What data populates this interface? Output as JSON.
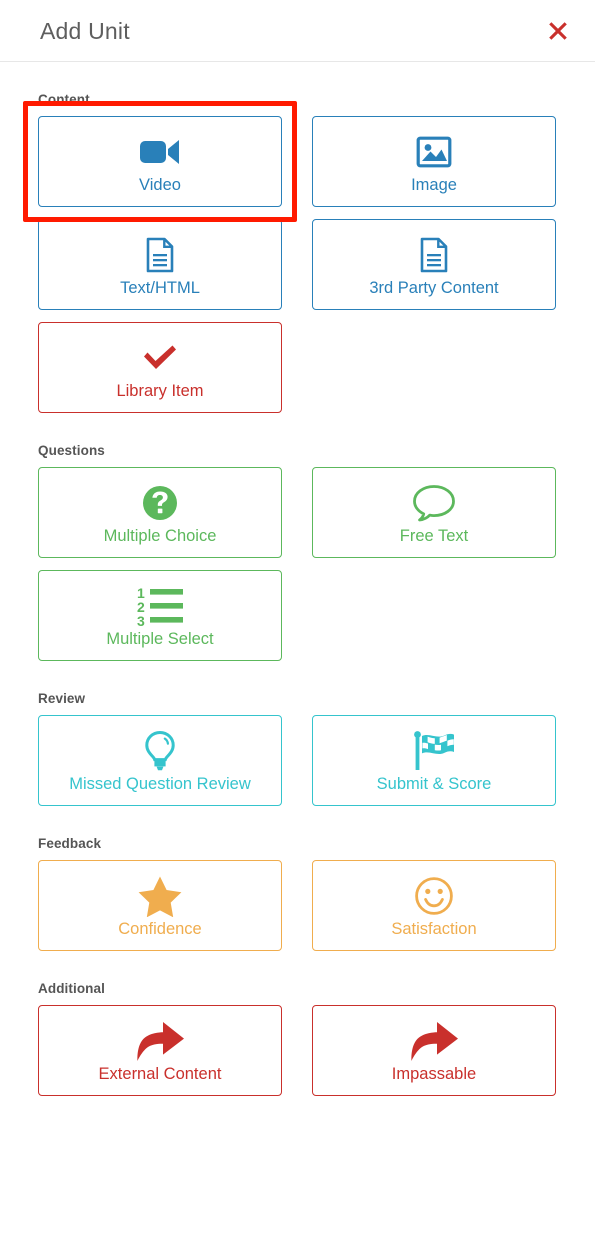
{
  "header": {
    "title": "Add Unit",
    "close_label": "Close",
    "close_icon": "close-x-icon",
    "close_color": "#c9302c"
  },
  "colors": {
    "content": "#2980b9",
    "library": "#c9302c",
    "questions": "#5cb85c",
    "review": "#35c4cd",
    "feedback": "#f0ad4e",
    "additional": "#c9302c",
    "selection_highlight": "#ff1a00",
    "section_label": "#555555",
    "title": "#5e5e5e"
  },
  "sections": [
    {
      "label": "Content",
      "items": [
        {
          "label": "Video",
          "icon": "video-camera-icon",
          "color": "blue",
          "selected": true
        },
        {
          "label": "Image",
          "icon": "image-picture-icon",
          "color": "blue",
          "selected": false
        },
        {
          "label": "Text/HTML",
          "icon": "document-icon",
          "color": "blue",
          "selected": false
        },
        {
          "label": "3rd Party Content",
          "icon": "document-icon",
          "color": "blue",
          "selected": false
        },
        {
          "label": "Library Item",
          "icon": "checkmark-icon",
          "color": "red",
          "selected": false
        }
      ]
    },
    {
      "label": "Questions",
      "items": [
        {
          "label": "Multiple Choice",
          "icon": "question-circle-icon",
          "color": "green",
          "selected": false
        },
        {
          "label": "Free Text",
          "icon": "speech-bubble-icon",
          "color": "green",
          "selected": false
        },
        {
          "label": "Multiple Select",
          "icon": "numbered-list-icon",
          "color": "green",
          "selected": false
        }
      ]
    },
    {
      "label": "Review",
      "items": [
        {
          "label": "Missed Question Review",
          "icon": "lightbulb-icon",
          "color": "teal",
          "selected": false
        },
        {
          "label": "Submit & Score",
          "icon": "checkered-flag-icon",
          "color": "teal",
          "selected": false
        }
      ]
    },
    {
      "label": "Feedback",
      "items": [
        {
          "label": "Confidence",
          "icon": "star-icon",
          "color": "orange",
          "selected": false
        },
        {
          "label": "Satisfaction",
          "icon": "smiley-face-icon",
          "color": "orange",
          "selected": false
        }
      ]
    },
    {
      "label": "Additional",
      "items": [
        {
          "label": "External Content",
          "icon": "share-arrow-icon",
          "color": "red",
          "selected": false
        },
        {
          "label": "Impassable",
          "icon": "share-arrow-icon",
          "color": "red",
          "selected": false
        }
      ]
    }
  ]
}
